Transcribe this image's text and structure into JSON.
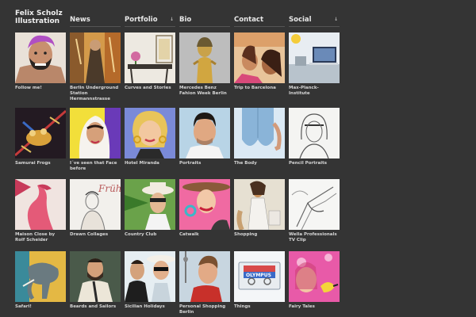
{
  "brand": {
    "line1": "Felix Scholz",
    "line2": "Illustration"
  },
  "nav": [
    {
      "label": "News",
      "caret": ""
    },
    {
      "label": "Portfolio",
      "caret": "↓"
    },
    {
      "label": "Bio",
      "caret": ""
    },
    {
      "label": "Contact",
      "caret": ""
    },
    {
      "label": "Social",
      "caret": "↓"
    }
  ],
  "tiles": [
    {
      "caption": "Follow me!"
    },
    {
      "caption": "Berlin Underground Station Hermannstrasse"
    },
    {
      "caption": "Curves and Stories"
    },
    {
      "caption": "Mercedes Benz Fahion Week Berlin"
    },
    {
      "caption": "Trip to Barcelona"
    },
    {
      "caption": "Max-Planck-Institute"
    },
    {
      "caption": "Samurai Frogs"
    },
    {
      "caption": "I´ve seen that Face before"
    },
    {
      "caption": "Hotel Miranda"
    },
    {
      "caption": "Portraits"
    },
    {
      "caption": "The Body"
    },
    {
      "caption": "Pencil Portraits"
    },
    {
      "caption": "Maison Close by Rolf Scheider"
    },
    {
      "caption": "Drawn Collages"
    },
    {
      "caption": "Country Club"
    },
    {
      "caption": "Catwalk"
    },
    {
      "caption": "Shopping"
    },
    {
      "caption": "Wella Professionals TV Clip"
    },
    {
      "caption": "Safari!"
    },
    {
      "caption": "Beards and Sailors"
    },
    {
      "caption": "Sicilian Holidays"
    },
    {
      "caption": "Personal Shopping Berlin"
    },
    {
      "caption": "Things"
    },
    {
      "caption": "Fairy Tales"
    }
  ],
  "thumb_text": {
    "magazine": "Früh",
    "cassette": "OLYMPUS"
  },
  "colors": {
    "background": "#343434",
    "text": "#e6e6e6",
    "caption": "#d6d6d6"
  }
}
